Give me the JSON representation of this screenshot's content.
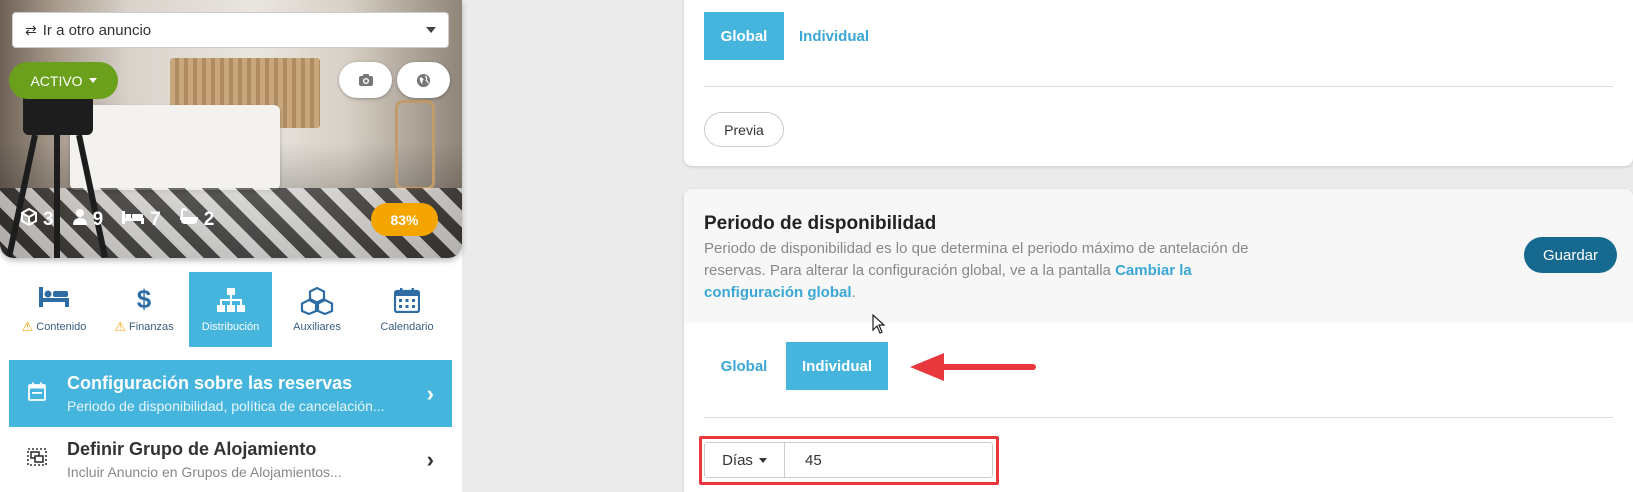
{
  "listing": {
    "select_label": "Ir a otro anuncio",
    "status_label": "ACTIVO",
    "stats": {
      "rooms": "3",
      "guests": "9",
      "beds": "7",
      "baths": "2"
    },
    "completion": "83%"
  },
  "nav": {
    "tabs": [
      {
        "label": "Contenido",
        "icon": "bed-icon",
        "warning": true
      },
      {
        "label": "Finanzas",
        "icon": "dollar-icon",
        "warning": true
      },
      {
        "label": "Distribución",
        "icon": "sitemap-icon",
        "warning": false,
        "active": true
      },
      {
        "label": "Auxiliares",
        "icon": "cubes-icon",
        "warning": false
      },
      {
        "label": "Calendario",
        "icon": "calendar-icon",
        "warning": false
      }
    ]
  },
  "menu": {
    "items": [
      {
        "title": "Configuración sobre las reservas",
        "subtitle": "Periodo de disponibilidad, política de cancelación..."
      },
      {
        "title": "Definir Grupo de Alojamiento",
        "subtitle": "Incluir Anuncio en Grupos de Alojamientos..."
      }
    ]
  },
  "top_card": {
    "tab_global": "Global",
    "tab_individual": "Individual",
    "preview_label": "Previa"
  },
  "availability": {
    "title": "Periodo de disponibilidad",
    "desc_text": "Periodo de disponibilidad es lo que determina el periodo máximo de antelación de reservas. Para alterar la configuración global, ve a la pantalla ",
    "desc_link": "Cambiar la configuración global",
    "desc_end": ".",
    "save_label": "Guardar",
    "tab_global": "Global",
    "tab_individual": "Individual",
    "unit_label": "Días",
    "days_value": "45"
  },
  "colors": {
    "accent": "#45b5de",
    "save": "#16698f",
    "status": "#6aa01b",
    "badge": "#f5a500",
    "highlight": "#e8383d"
  }
}
